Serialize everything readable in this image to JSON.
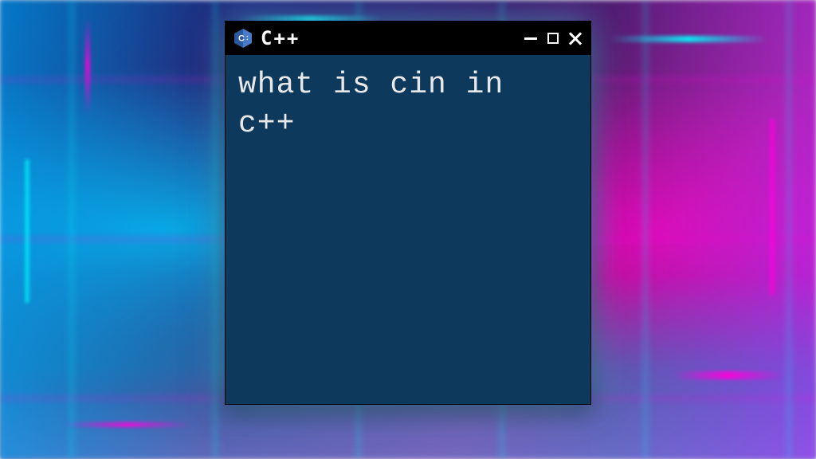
{
  "window": {
    "title": "C++",
    "content": "what is cin in c++"
  },
  "colors": {
    "terminal_bg": "#0d3a5c",
    "titlebar_bg": "#000000",
    "text": "#e8e8e8",
    "icon_primary": "#2c5aa0",
    "icon_secondary": "#4a7bc8"
  }
}
